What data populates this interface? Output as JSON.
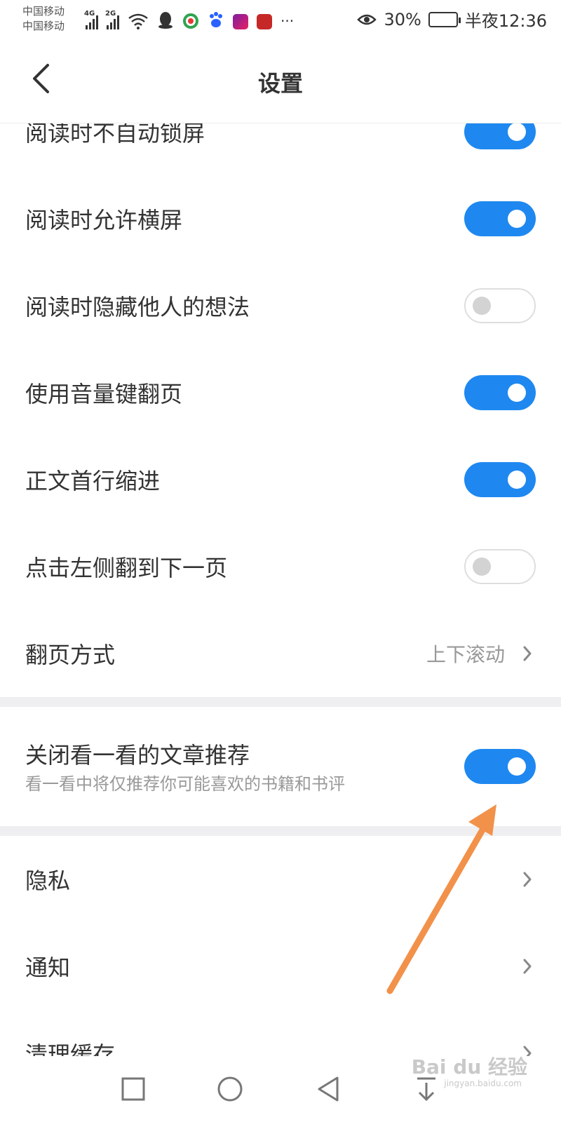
{
  "status_bar": {
    "carrier_1": "中国移动",
    "carrier_2": "中国移动",
    "signal_1_tag": "4G",
    "signal_2_tag": "2G",
    "more_label": "···",
    "battery_text": "30%",
    "battery_level_percent": 30,
    "time": "半夜12:36"
  },
  "header": {
    "title": "设置"
  },
  "toggles": [
    {
      "label": "阅读时不自动锁屏",
      "on": true
    },
    {
      "label": "阅读时允许横屏",
      "on": true
    },
    {
      "label": "阅读时隐藏他人的想法",
      "on": false
    },
    {
      "label": "使用音量键翻页",
      "on": true
    },
    {
      "label": "正文首行缩进",
      "on": true
    },
    {
      "label": "点击左侧翻到下一页",
      "on": false
    }
  ],
  "page_turn": {
    "label": "翻页方式",
    "value": "上下滚动"
  },
  "recommend": {
    "label": "关闭看一看的文章推荐",
    "sublabel": "看一看中将仅推荐你可能喜欢的书籍和书评",
    "on": true
  },
  "menu": [
    {
      "label": "隐私"
    },
    {
      "label": "通知"
    },
    {
      "label": "清理缓存"
    }
  ],
  "watermark": {
    "text": "Bai du 经验",
    "sub": "jingyan.baidu.com"
  },
  "colors": {
    "accent": "#1e88f0",
    "annotation_arrow": "#f2914a",
    "separator": "#efeff1"
  }
}
